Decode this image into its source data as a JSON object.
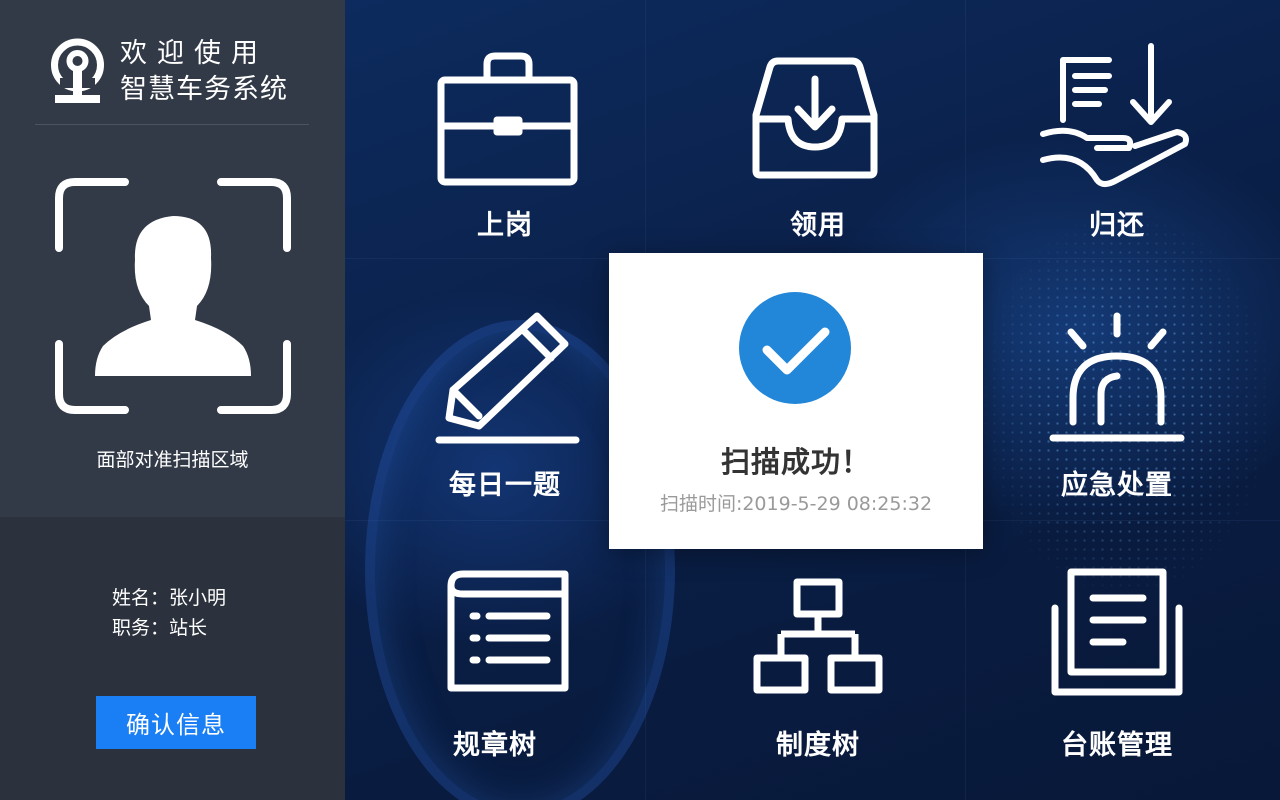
{
  "sidebar": {
    "welcome": "欢迎使用",
    "system_name": "智慧车务系统",
    "face_hint": "面部对准扫描区域",
    "user": {
      "name_label": "姓名：",
      "name_value": "张小明",
      "role_label": "职务：",
      "role_value": "站长"
    },
    "confirm_label": "确认信息"
  },
  "menu": [
    {
      "label": "上岗",
      "icon": "briefcase-icon"
    },
    {
      "label": "领用",
      "icon": "inbox-download-icon"
    },
    {
      "label": "归还",
      "icon": "hand-return-icon"
    },
    {
      "label": "每日一题",
      "icon": "pencil-icon"
    },
    {
      "label": "应急处置",
      "icon": "alarm-light-icon"
    },
    {
      "label": "规章树",
      "icon": "book-list-icon"
    },
    {
      "label": "制度树",
      "icon": "org-tree-icon"
    },
    {
      "label": "台账管理",
      "icon": "ledger-icon"
    }
  ],
  "modal": {
    "title": "扫描成功！",
    "time": "扫描时间:2019-5-29 08:25:32"
  },
  "colors": {
    "accent": "#1a7ef5",
    "check": "#2286d9",
    "sidebar_bg": "#333a47"
  }
}
